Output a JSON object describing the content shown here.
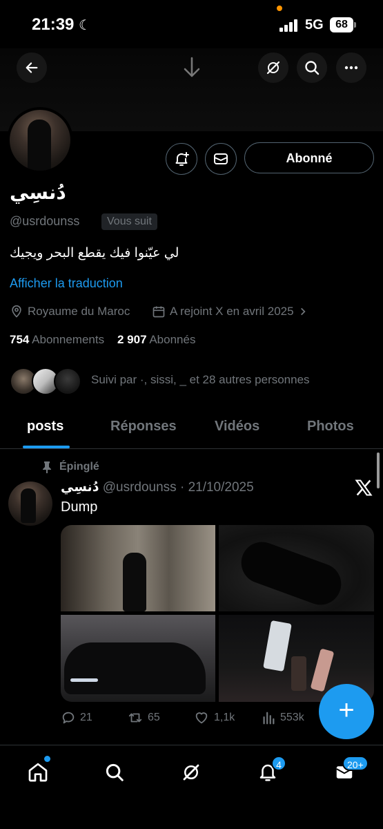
{
  "status_bar": {
    "time": "21:39",
    "network": "5G",
    "battery": "68"
  },
  "profile": {
    "name": "دُنسِي",
    "handle": "@usrdounss",
    "follows_you": "Vous suit",
    "follow_button": "Abonné",
    "bio": "لي عيّنوا فيك يقطع البحر ويجيك",
    "translate": "Afficher la traduction",
    "location": "Royaume du Maroc",
    "joined": "A rejoint X en avril 2025",
    "following_count": "754",
    "following_label": "Abonnements",
    "followers_count": "2 907",
    "followers_label": "Abonnés",
    "followed_by": "Suivi par ·, sissi, _ et 28 autres personnes"
  },
  "tabs": [
    "posts",
    "Réponses",
    "Vidéos",
    "Photos"
  ],
  "post": {
    "pinned_label": "Épinglé",
    "author": "دُنسِي",
    "meta": "@usrdounss · 21/10/2025",
    "text": "Dump",
    "replies": "21",
    "reposts": "65",
    "likes": "1,1k",
    "views": "553k"
  },
  "nav": {
    "notifications_badge": "4",
    "messages_badge": "20+"
  },
  "colors": {
    "accent": "#1d9bf0",
    "background": "#000000",
    "muted": "#71767b"
  }
}
